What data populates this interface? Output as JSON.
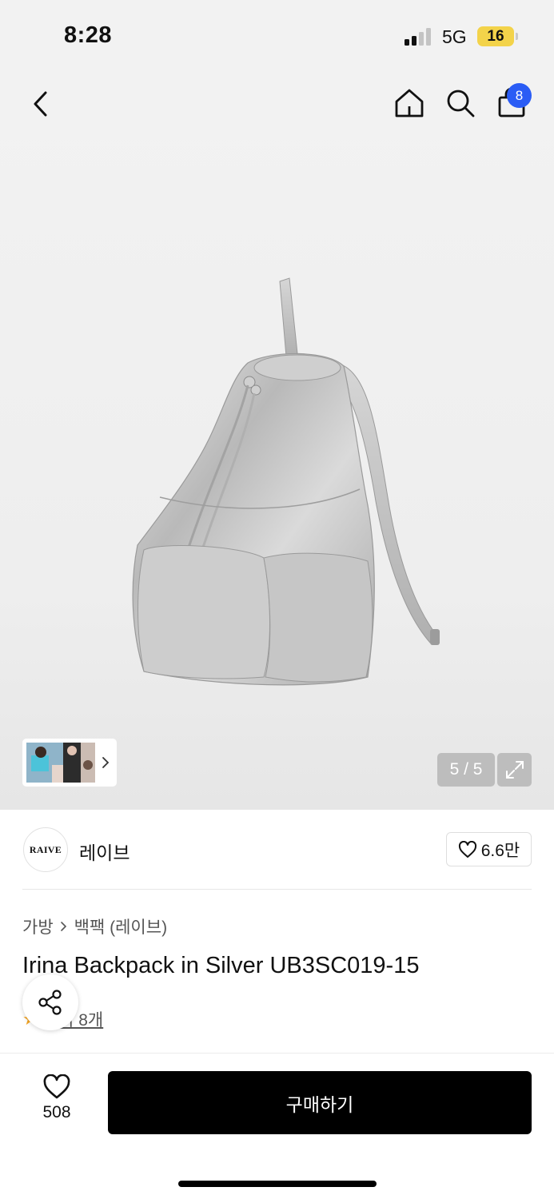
{
  "status_bar": {
    "time": "8:28",
    "network": "5G",
    "battery": "16"
  },
  "header": {
    "cart_count": "8"
  },
  "gallery": {
    "counter": "5 / 5"
  },
  "brand": {
    "logo_text": "RAIVE",
    "name": "레이브",
    "likes": "6.6만"
  },
  "product": {
    "breadcrumb": [
      "가방",
      "백팩 (레이브)"
    ],
    "title": "Irina Backpack in Silver UB3SC019-15",
    "reviews": "후기 8개"
  },
  "bottom_bar": {
    "wish_count": "508",
    "buy_label": "구매하기"
  },
  "icons": {
    "back": "chevron-left-icon",
    "home": "home-icon",
    "search": "search-icon",
    "cart": "shopping-bag-icon",
    "expand": "expand-icon",
    "share": "share-icon",
    "heart": "heart-icon"
  },
  "colors": {
    "badge": "#2a5cf5",
    "buy_button": "#000000",
    "battery": "#f3d34a"
  }
}
